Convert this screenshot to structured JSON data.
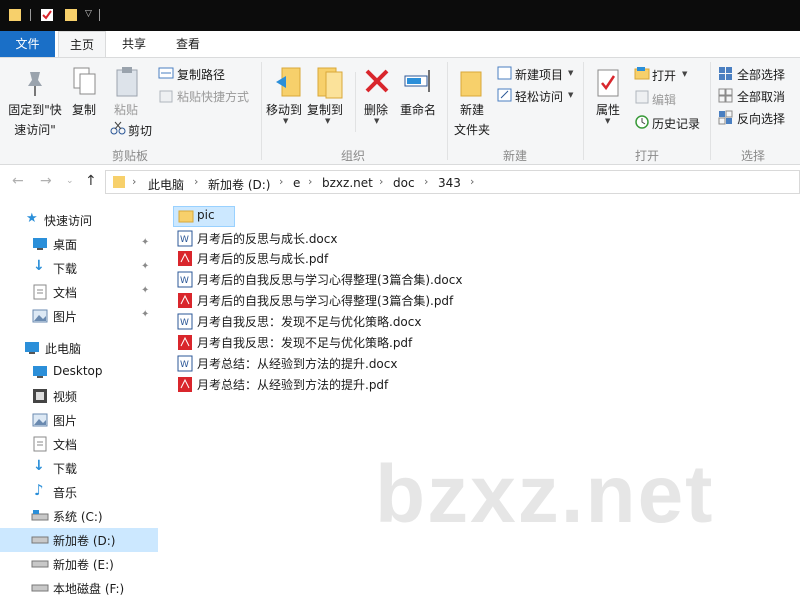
{
  "ribbon_tabs": [
    "文件",
    "主页",
    "共享",
    "查看"
  ],
  "ribbon": {
    "clipboard": {
      "pin_label_1": "固定到\"快",
      "pin_label_2": "速访问\"",
      "copy": "复制",
      "paste": "粘贴",
      "copy_path": "复制路径",
      "paste_shortcut": "粘贴快捷方式",
      "cut": "剪切",
      "group": "剪贴板"
    },
    "organize": {
      "move_to": "移动到",
      "copy_to": "复制到",
      "delete": "删除",
      "rename": "重命名",
      "group": "组织"
    },
    "new": {
      "new_folder_1": "新建",
      "new_folder_2": "文件夹",
      "new_item": "新建项目",
      "easy_access": "轻松访问",
      "group": "新建"
    },
    "open": {
      "properties": "属性",
      "open": "打开",
      "edit": "编辑",
      "history": "历史记录",
      "group": "打开"
    },
    "select": {
      "select_all": "全部选择",
      "select_none": "全部取消",
      "invert": "反向选择",
      "group": "选择"
    }
  },
  "breadcrumb": [
    "此电脑",
    "新加卷 (D:)",
    "e",
    "bzxz.net",
    "doc",
    "343"
  ],
  "sidebar": {
    "quick_access": "快速访问",
    "quick_items": [
      "桌面",
      "下载",
      "文档",
      "图片"
    ],
    "this_pc": "此电脑",
    "pc_items": [
      "Desktop",
      "视频",
      "图片",
      "文档",
      "下载",
      "音乐",
      "系统 (C:)",
      "新加卷 (D:)",
      "新加卷 (E:)",
      "本地磁盘 (F:)"
    ]
  },
  "files": [
    {
      "name": "pic",
      "type": "folder"
    },
    {
      "name": "月考后的反思与成长.docx",
      "type": "docx"
    },
    {
      "name": "月考后的反思与成长.pdf",
      "type": "pdf"
    },
    {
      "name": "月考后的自我反思与学习心得整理(3篇合集).docx",
      "type": "docx"
    },
    {
      "name": "月考后的自我反思与学习心得整理(3篇合集).pdf",
      "type": "pdf"
    },
    {
      "name": "月考自我反思：发现不足与优化策略.docx",
      "type": "docx"
    },
    {
      "name": "月考自我反思：发现不足与优化策略.pdf",
      "type": "pdf"
    },
    {
      "name": "月考总结：从经验到方法的提升.docx",
      "type": "docx"
    },
    {
      "name": "月考总结：从经验到方法的提升.pdf",
      "type": "pdf"
    }
  ],
  "watermark": "bzxz.net",
  "colors": {
    "accent": "#1a6fc7",
    "selection": "#cce8ff",
    "folder": "#f7d06b",
    "pdf": "#d9262c",
    "docx": "#2b5797"
  }
}
